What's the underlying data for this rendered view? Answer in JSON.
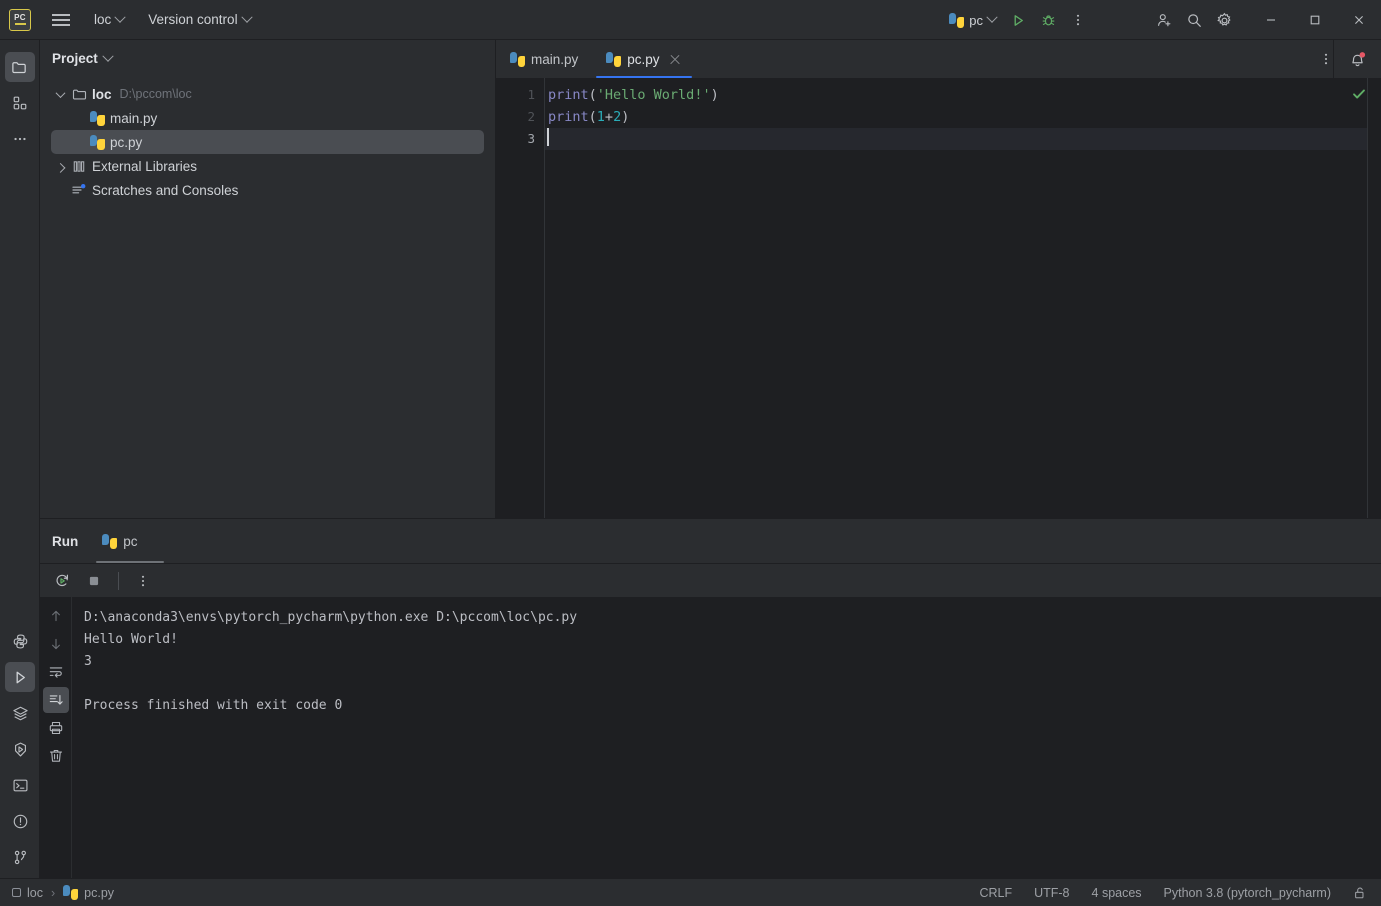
{
  "titlebar": {
    "logo_text": "PC",
    "menu_icon": "hamburger-icon",
    "project_name": "loc",
    "version_control": "Version control",
    "run_config": "pc",
    "icons": {
      "run": "run-icon",
      "debug": "debug-icon",
      "more": "more-vertical-icon",
      "account": "add-user-icon",
      "search": "search-icon",
      "settings": "gear-icon",
      "minimize": "minimize-icon",
      "maximize": "maximize-icon",
      "close": "close-icon"
    }
  },
  "activitybar": {
    "top": [
      {
        "name": "project-tool-window",
        "icon": "folder-icon",
        "selected": true
      },
      {
        "name": "structure-tool-window",
        "icon": "structure-icon",
        "selected": false
      },
      {
        "name": "more-tool-windows",
        "icon": "ellipsis-icon",
        "selected": false
      }
    ],
    "bottom": [
      {
        "name": "python-console",
        "icon": "python-icon",
        "selected": false
      },
      {
        "name": "run-tool-window",
        "icon": "run-icon",
        "selected": true
      },
      {
        "name": "services-tool-window",
        "icon": "layers-icon",
        "selected": false
      },
      {
        "name": "coverage-tool-window",
        "icon": "run-coverage-icon",
        "selected": false
      },
      {
        "name": "terminal-tool-window",
        "icon": "terminal-icon",
        "selected": false
      },
      {
        "name": "problems-tool-window",
        "icon": "warning-circle-icon",
        "selected": false
      },
      {
        "name": "version-control-tool-window",
        "icon": "git-branch-icon",
        "selected": false
      }
    ]
  },
  "project_panel": {
    "title": "Project",
    "tree": [
      {
        "label": "loc",
        "path": "D:\\pccom\\loc",
        "type": "folder",
        "expanded": true,
        "depth": 0,
        "selected": false
      },
      {
        "label": "main.py",
        "path": "",
        "type": "python",
        "depth": 1,
        "selected": false
      },
      {
        "label": "pc.py",
        "path": "",
        "type": "python",
        "depth": 1,
        "selected": true
      },
      {
        "label": "External Libraries",
        "path": "",
        "type": "library",
        "expanded": false,
        "depth": 0,
        "selected": false
      },
      {
        "label": "Scratches and Consoles",
        "path": "",
        "type": "scratches",
        "depth": 0,
        "selected": false
      }
    ]
  },
  "editor": {
    "tabs": [
      {
        "label": "main.py",
        "active": false,
        "closable": false
      },
      {
        "label": "pc.py",
        "active": true,
        "closable": true
      }
    ],
    "inspection_status": "ok-check",
    "notification_badge": true,
    "lines": [
      {
        "number": "1",
        "current": false,
        "tokens": [
          {
            "t": "print",
            "c": "kw"
          },
          {
            "t": "(",
            "c": "pn"
          },
          {
            "t": "'Hello World!'",
            "c": "str"
          },
          {
            "t": ")",
            "c": "pn"
          }
        ]
      },
      {
        "number": "2",
        "current": false,
        "tokens": [
          {
            "t": "print",
            "c": "kw"
          },
          {
            "t": "(",
            "c": "pn"
          },
          {
            "t": "1",
            "c": "num"
          },
          {
            "t": "+",
            "c": "pn"
          },
          {
            "t": "2",
            "c": "num"
          },
          {
            "t": ")",
            "c": "pn"
          }
        ]
      },
      {
        "number": "3",
        "current": true,
        "tokens": []
      }
    ]
  },
  "run_panel": {
    "title": "Run",
    "tab_label": "pc",
    "toolbar": {
      "rerun": "rerun-icon",
      "stop": "stop-icon",
      "more": "more-vertical-icon"
    },
    "console_gutter": [
      {
        "name": "scroll-up-button",
        "icon": "arrow-up-icon",
        "selected": false
      },
      {
        "name": "scroll-down-button",
        "icon": "arrow-down-icon",
        "selected": false
      },
      {
        "name": "soft-wrap-button",
        "icon": "soft-wrap-icon",
        "selected": false
      },
      {
        "name": "scroll-to-end-button",
        "icon": "scroll-to-end-icon",
        "selected": true
      },
      {
        "name": "print-button",
        "icon": "print-icon",
        "selected": false
      },
      {
        "name": "clear-all-button",
        "icon": "trash-icon",
        "selected": false
      }
    ],
    "output": "D:\\anaconda3\\envs\\pytorch_pycharm\\python.exe D:\\pccom\\loc\\pc.py\nHello World!\n3\n\nProcess finished with exit code 0"
  },
  "status_bar": {
    "breadcrumb_project": "loc",
    "breadcrumb_separator": "›",
    "breadcrumb_file": "pc.py",
    "line_separator": "CRLF",
    "encoding": "UTF-8",
    "indent": "4 spaces",
    "interpreter": "Python 3.8 (pytorch_pycharm)",
    "lock_icon": "unlocked-icon"
  },
  "colors": {
    "accent": "#3574f0",
    "run_green": "#5fad65",
    "selection": "#4a4d52",
    "editor_bg": "#1e1f22",
    "panel_bg": "#2b2d30",
    "string": "#6aab73",
    "number": "#2aacb8",
    "keyword": "#8888c6"
  }
}
